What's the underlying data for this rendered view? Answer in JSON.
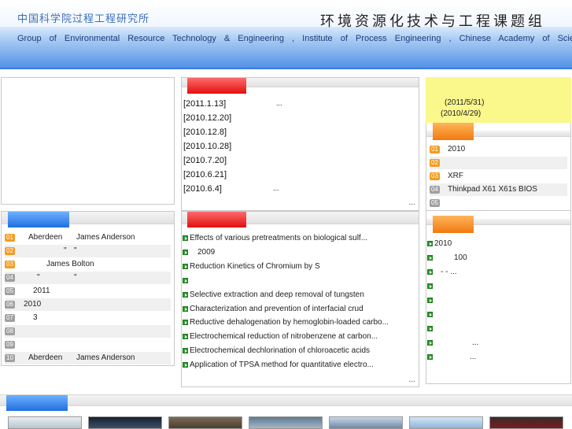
{
  "header": {
    "institute_cn": "中国科学院过程工程研究所",
    "group_cn": "环境资源化技术与工程课题组",
    "group_en": "Group of Environmental Resource Technology & Engineering , Institute of Process Engineering , Chinese Academy of Sciences"
  },
  "news": {
    "items": [
      {
        "date": "[2011.1.13]",
        "trail": "..."
      },
      {
        "date": "[2010.12.20]",
        "trail": ""
      },
      {
        "date": "[2010.12.8]",
        "trail": ""
      },
      {
        "date": "[2010.10.28]",
        "trail": ""
      },
      {
        "date": "[2010.7.20]",
        "trail": ""
      },
      {
        "date": "[2010.6.21]",
        "trail": ""
      },
      {
        "date": "[2010.6.4]",
        "trail": "..."
      }
    ],
    "more": "..."
  },
  "notice": {
    "line1": "(2011/5/31)",
    "line2": "(2010/4/29)"
  },
  "ranked_right": {
    "items": [
      {
        "num": "01",
        "text": "2010"
      },
      {
        "num": "02",
        "text": ""
      },
      {
        "num": "03",
        "text": "XRF"
      },
      {
        "num": "04",
        "text": "Thinkpad X61 X61s   BIOS"
      },
      {
        "num": "05",
        "text": ""
      }
    ]
  },
  "ranked_left": {
    "items": [
      {
        "num": "01",
        "a": "Aberdeen",
        "b": "James Anderson"
      },
      {
        "num": "02",
        "a": "\"",
        "b": "\""
      },
      {
        "num": "03",
        "a": "",
        "b": "James Bolton"
      },
      {
        "num": "04",
        "a": "\"",
        "b": "\""
      },
      {
        "num": "05",
        "a": "2011",
        "b": ""
      },
      {
        "num": "06",
        "a": "2010",
        "b": ""
      },
      {
        "num": "07",
        "a": "3",
        "b": ""
      },
      {
        "num": "08",
        "a": "",
        "b": ""
      },
      {
        "num": "09",
        "a": "",
        "b": ""
      },
      {
        "num": "10",
        "a": "Aberdeen",
        "b": "James Anderson"
      }
    ]
  },
  "papers": {
    "items": [
      "Effects of various pretreatments on biological sulf...",
      "2009",
      "Reduction Kinetics of Chromium by S",
      "",
      "Selective extraction and deep removal of tungsten",
      "Characterization and prevention of interfacial crud",
      "Reductive dehalogenation by hemoglobin-loaded carbo...",
      "Electrochemical reduction of nitrobenzene at carbon...",
      "Electrochemical dechlorination of chloroacetic acids",
      "Application of TPSA method for quantitative electro..."
    ],
    "more": "..."
  },
  "links_right": {
    "items": [
      "2010",
      "100",
      "- -         ...",
      "",
      "",
      "",
      "",
      "...",
      "..."
    ]
  },
  "colors": {
    "accent_blue": "#3a7de0",
    "tab_red": "#e01010",
    "tab_orange": "#f07a10",
    "notice_yellow": "#faf78b",
    "bullet_green": "#2e9a2e"
  }
}
